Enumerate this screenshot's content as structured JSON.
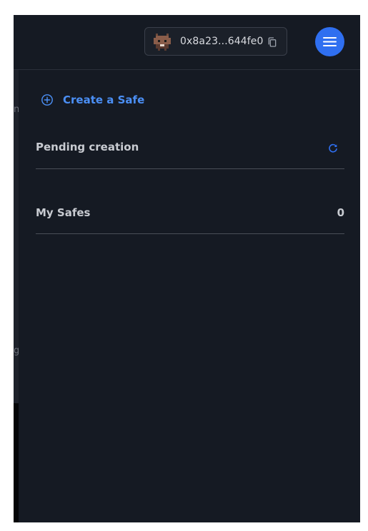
{
  "header": {
    "account": {
      "address": "0x8a23...644fe0",
      "avatar_icon": "robot-avatar-icon",
      "copy_icon": "copy-icon"
    },
    "menu_icon": "hamburger-menu-icon"
  },
  "panel": {
    "create_safe": {
      "label": "Create a Safe",
      "icon": "plus-circle-icon"
    },
    "pending": {
      "title": "Pending creation",
      "icon": "refresh-icon"
    },
    "my_safes": {
      "title": "My Safes",
      "count": "0"
    }
  },
  "colors": {
    "background": "#151a23",
    "accent": "#2f6ff0",
    "link": "#4b8ff5",
    "text": "#c8cbd1"
  }
}
